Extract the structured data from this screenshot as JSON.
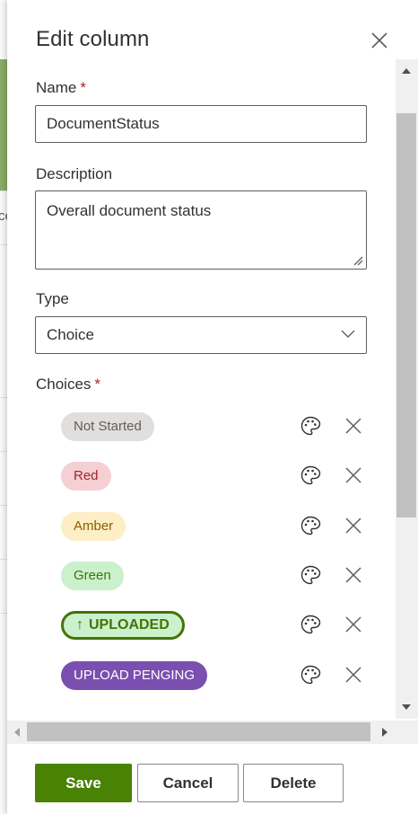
{
  "background": {
    "partial_glyph": "ce"
  },
  "panel": {
    "title": "Edit column",
    "close_icon": "close-icon"
  },
  "fields": {
    "name": {
      "label": "Name",
      "required_mark": "*",
      "value": "DocumentStatus"
    },
    "description": {
      "label": "Description",
      "value": "Overall document status"
    },
    "type": {
      "label": "Type",
      "value": "Choice"
    }
  },
  "choices": {
    "label": "Choices",
    "required_mark": "*",
    "items": [
      {
        "label": "Not Started",
        "bg": "#e1dfdd",
        "fg": "#605e5c",
        "border": "none",
        "bold": false,
        "prefix": ""
      },
      {
        "label": "Red",
        "bg": "#f4cfd3",
        "fg": "#a4262c",
        "border": "none",
        "bold": false,
        "prefix": ""
      },
      {
        "label": "Amber",
        "bg": "#fdeec5",
        "fg": "#8a5f00",
        "border": "none",
        "bold": false,
        "prefix": ""
      },
      {
        "label": "Green",
        "bg": "#caf0cc",
        "fg": "#437406",
        "border": "none",
        "bold": false,
        "prefix": ""
      },
      {
        "label": "UPLOADED",
        "bg": "#caf0cc",
        "fg": "#437406",
        "border": "3px solid #437406",
        "bold": true,
        "prefix": "↑"
      },
      {
        "label": "UPLOAD PENGING",
        "bg": "#7a4fb0",
        "fg": "#ffffff",
        "border": "none",
        "bold": false,
        "prefix": ""
      }
    ]
  },
  "footer": {
    "save": "Save",
    "cancel": "Cancel",
    "delete": "Delete"
  },
  "colors": {
    "primary": "#498205",
    "required": "#a4262c"
  }
}
